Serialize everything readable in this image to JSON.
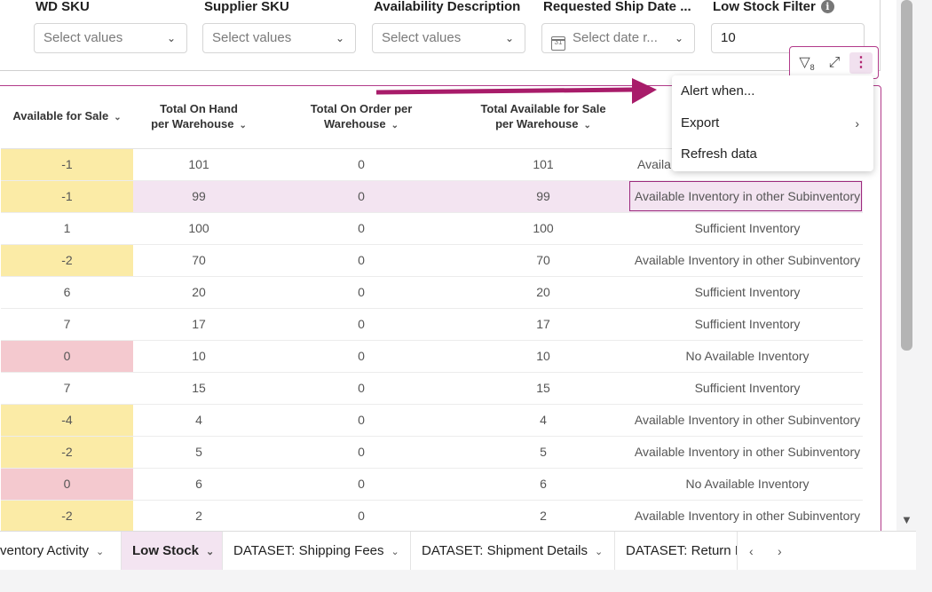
{
  "filters": [
    {
      "label": "WD SKU",
      "value": "Select values",
      "type": "select"
    },
    {
      "label": "Supplier SKU",
      "value": "Select values",
      "type": "select"
    },
    {
      "label": "Availability Description",
      "value": "Select values",
      "type": "select"
    },
    {
      "label": "Requested Ship Date ...",
      "value": "Select date r...",
      "type": "date"
    },
    {
      "label": "Low Stock Filter",
      "value": "10",
      "type": "number"
    }
  ],
  "toolbar": {
    "filter_count": "8",
    "filter_icon": "funnel-icon",
    "expand_icon": "expand-icon",
    "more_icon": "kebab-icon"
  },
  "table": {
    "headers": [
      "Available for Sale",
      "Total On Hand per Warehouse",
      "Total On Order per Warehouse",
      "Total Available for Sale per Warehouse",
      ""
    ],
    "rows": [
      [
        "-1",
        "101",
        "0",
        "101",
        "Availa"
      ],
      [
        "-1",
        "99",
        "0",
        "99",
        "Available Inventory in other Subinventory"
      ],
      [
        "1",
        "100",
        "0",
        "100",
        "Sufficient Inventory"
      ],
      [
        "-2",
        "70",
        "0",
        "70",
        "Available Inventory in other Subinventory"
      ],
      [
        "6",
        "20",
        "0",
        "20",
        "Sufficient Inventory"
      ],
      [
        "7",
        "17",
        "0",
        "17",
        "Sufficient Inventory"
      ],
      [
        "0",
        "10",
        "0",
        "10",
        "No Available Inventory"
      ],
      [
        "7",
        "15",
        "0",
        "15",
        "Sufficient Inventory"
      ],
      [
        "-4",
        "4",
        "0",
        "4",
        "Available Inventory in other Subinventory"
      ],
      [
        "-2",
        "5",
        "0",
        "5",
        "Available Inventory in other Subinventory"
      ],
      [
        "0",
        "6",
        "0",
        "6",
        "No Available Inventory"
      ],
      [
        "-2",
        "2",
        "0",
        "2",
        "Available Inventory in other Subinventory"
      ]
    ]
  },
  "menu": {
    "items": [
      {
        "label": "Alert when...",
        "has_submenu": false
      },
      {
        "label": "Export",
        "has_submenu": true
      },
      {
        "label": "Refresh data",
        "has_submenu": false
      }
    ]
  },
  "tabs": [
    {
      "label": "ventory Activity",
      "active": false
    },
    {
      "label": "Low Stock",
      "active": true
    },
    {
      "label": "DATASET: Shipping Fees",
      "active": false
    },
    {
      "label": "DATASET: Shipment Details",
      "active": false
    },
    {
      "label": "DATASET: Return F",
      "active": false
    }
  ],
  "colors": {
    "accent": "#b0226f",
    "negative": "#fbeba6",
    "zero": "#f4c9cf",
    "selected_row": "#f3e4f1"
  }
}
